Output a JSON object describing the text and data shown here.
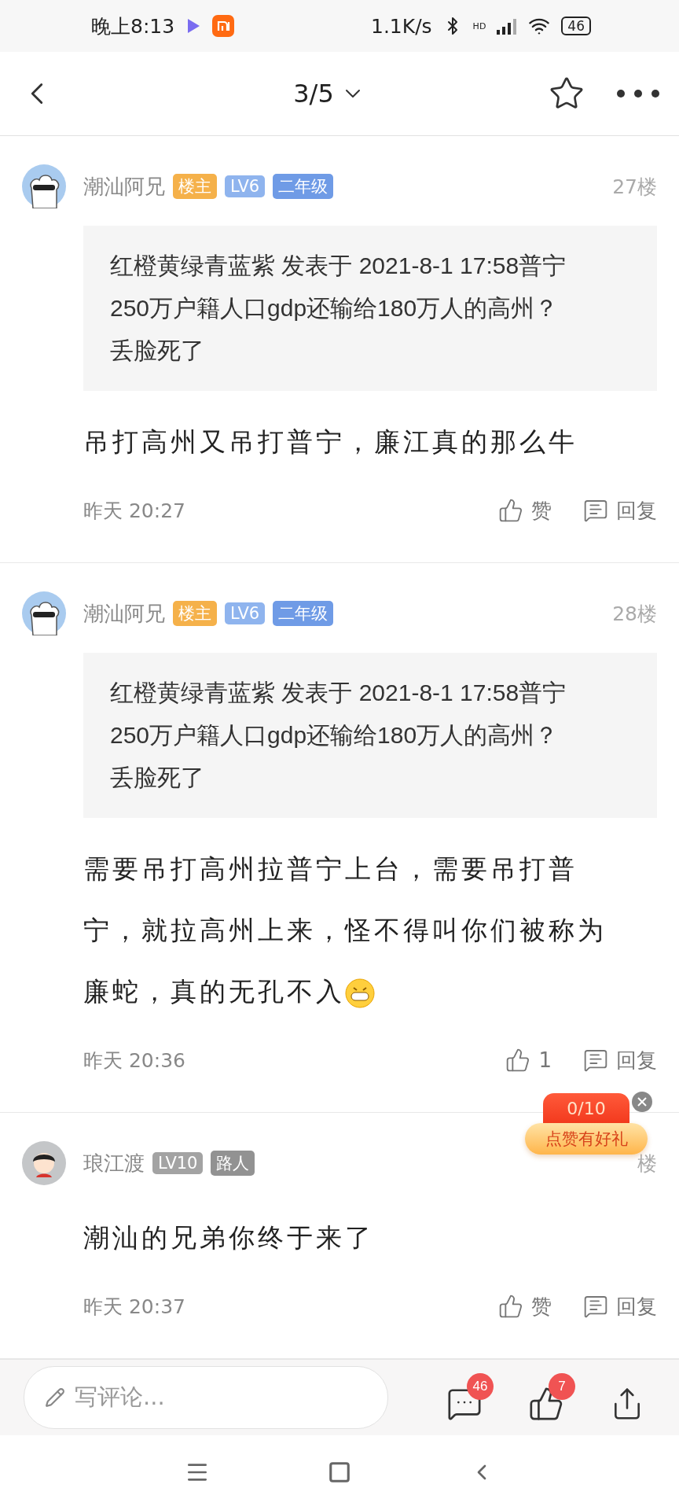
{
  "status_bar": {
    "time": "晚上8:13",
    "speed": "1.1K/s",
    "network": "HD",
    "battery": "46"
  },
  "nav": {
    "page": "3/5"
  },
  "comments": [
    {
      "avatar": {
        "kind": "cloud"
      },
      "author": "潮汕阿兄",
      "badges": [
        {
          "text": "楼主",
          "color": "#f5b14a"
        },
        {
          "text": "LV6",
          "color": "#8fb4ee"
        },
        {
          "text": "二年级",
          "color": "#6f9be6"
        }
      ],
      "floor": "27楼",
      "quote": "红橙黄绿青蓝紫 发表于 2021-8-1 17:58普宁250万户籍人口gdp还输给180万人的高州？丢脸死了",
      "content": "吊打高州又吊打普宁，廉江真的那么牛",
      "emoji": false,
      "time": "昨天 20:27",
      "likes": "赞",
      "reply": "回复"
    },
    {
      "avatar": {
        "kind": "cloud"
      },
      "author": "潮汕阿兄",
      "badges": [
        {
          "text": "楼主",
          "color": "#f5b14a"
        },
        {
          "text": "LV6",
          "color": "#8fb4ee"
        },
        {
          "text": "二年级",
          "color": "#6f9be6"
        }
      ],
      "floor": "28楼",
      "quote": "红橙黄绿青蓝紫 发表于 2021-8-1 17:58普宁250万户籍人口gdp还输给180万人的高州？丢脸死了",
      "content": "需要吊打高州拉普宁上台，需要吊打普宁，就拉高州上来，怪不得叫你们被称为廉蛇，真的无孔不入",
      "emoji": true,
      "time": "昨天 20:36",
      "likes": "1",
      "reply": "回复"
    },
    {
      "avatar": {
        "kind": "kid"
      },
      "author": "琅江渡",
      "badges": [
        {
          "text": "LV10",
          "color": "#a3a3a3"
        },
        {
          "text": "路人",
          "color": "#929292"
        }
      ],
      "floor": "楼",
      "content": "潮汕的兄弟你终于来了",
      "emoji": false,
      "time": "昨天 20:37",
      "likes": "赞",
      "reply": "回复"
    }
  ],
  "reward": {
    "count": "0/10",
    "label": "点赞有好礼"
  },
  "bottom_bar": {
    "placeholder": "写评论...",
    "comment_count": "46",
    "like_count": "7"
  }
}
